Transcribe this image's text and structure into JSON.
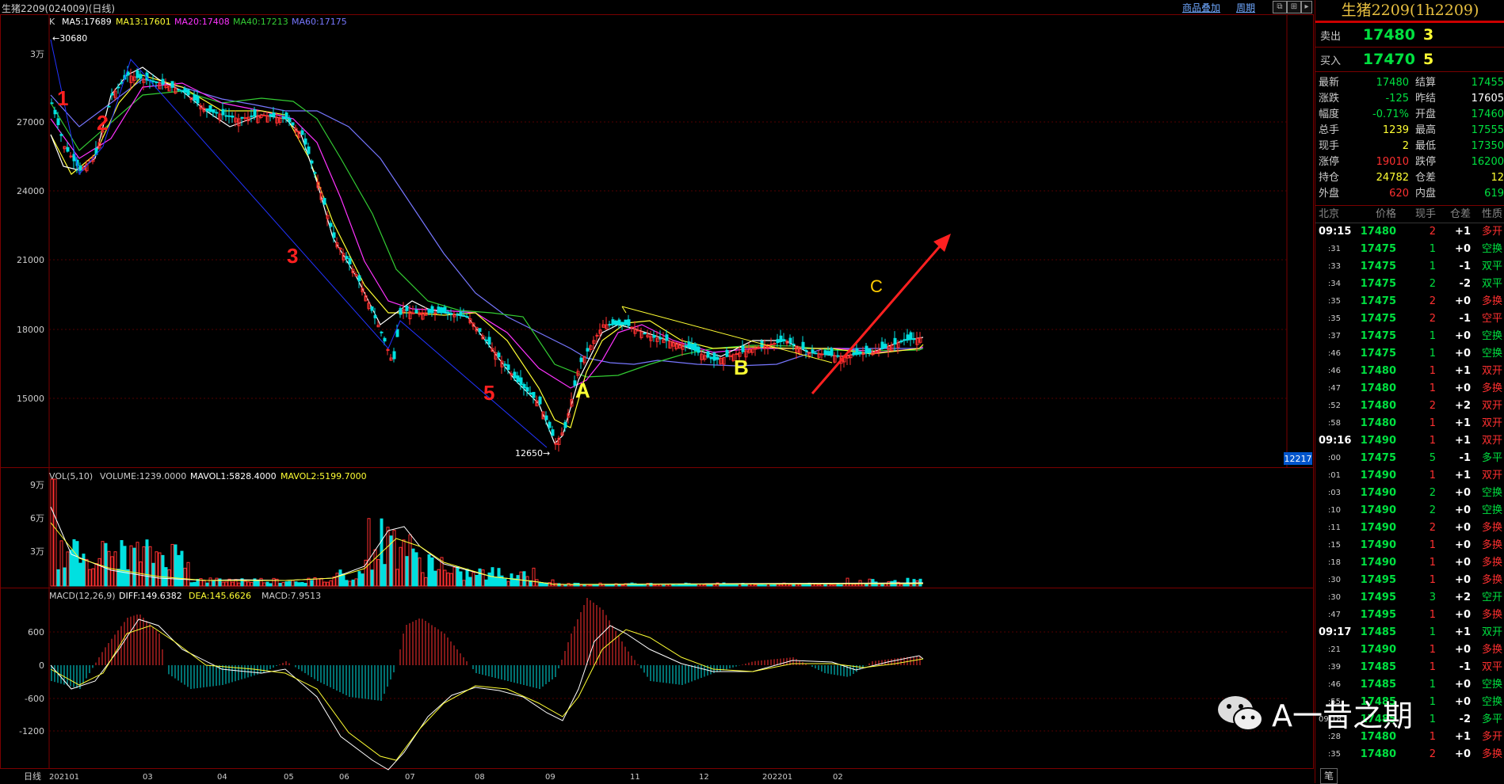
{
  "window": {
    "title": "生猪2209(024009)(日线)",
    "link1": "商品叠加",
    "link2": "周期"
  },
  "main_legend": {
    "k": "K",
    "ma5": "MA5:17689",
    "ma13": "MA13:17601",
    "ma20": "MA20:17408",
    "ma40": "MA40:17213",
    "ma60": "MA60:17175"
  },
  "price_axis": [
    "3万",
    "27000",
    "24000",
    "21000",
    "18000",
    "15000"
  ],
  "max_label": "30680",
  "min_label": "12650",
  "current_price_tag": "12217",
  "wave_labels": [
    "1",
    "2",
    "3",
    "5",
    "A",
    "B",
    "C"
  ],
  "vol_legend": {
    "title": "VOL(5,10)",
    "volume": "VOLUME:1239.0000",
    "mavol1": "MAVOL1:5828.4000",
    "mavol2": "MAVOL2:5199.7000"
  },
  "vol_axis": [
    "9万",
    "6万",
    "3万"
  ],
  "macd_legend": {
    "title": "MACD(12,26,9)",
    "diff": "DIFF:149.6382",
    "dea": "DEA:145.6626",
    "macd": "MACD:7.9513"
  },
  "macd_axis": [
    "600",
    "0",
    "-600",
    "-1200"
  ],
  "x_axis": {
    "period": "日线",
    "labels": [
      "202101",
      "03",
      "04",
      "05",
      "06",
      "07",
      "08",
      "09",
      "11",
      "12",
      "202201",
      "02"
    ]
  },
  "side": {
    "title": "生猪2209(1h2209)",
    "sell_label": "卖出",
    "sell_price": "17480",
    "sell_qty": "3",
    "buy_label": "买入",
    "buy_price": "17470",
    "buy_qty": "5",
    "stats": [
      {
        "l1": "最新",
        "v1": "17480",
        "c1": "#00e040",
        "l2": "结算",
        "v2": "17455",
        "c2": "#00e040"
      },
      {
        "l1": "涨跌",
        "v1": "-125",
        "c1": "#00e040",
        "l2": "昨结",
        "v2": "17605",
        "c2": "#ffffff"
      },
      {
        "l1": "幅度",
        "v1": "-0.71%",
        "c1": "#00e040",
        "l2": "开盘",
        "v2": "17460",
        "c2": "#00e040"
      },
      {
        "l1": "总手",
        "v1": "1239",
        "c1": "#ffff33",
        "l2": "最高",
        "v2": "17555",
        "c2": "#00e040"
      },
      {
        "l1": "现手",
        "v1": "2",
        "c1": "#ffff33",
        "l2": "最低",
        "v2": "17350",
        "c2": "#00e040"
      },
      {
        "l1": "涨停",
        "v1": "19010",
        "c1": "#ff3030",
        "l2": "跌停",
        "v2": "16200",
        "c2": "#00e040"
      },
      {
        "l1": "持仓",
        "v1": "24782",
        "c1": "#ffff33",
        "l2": "仓差",
        "v2": "12",
        "c2": "#ffff33"
      },
      {
        "l1": "外盘",
        "v1": "620",
        "c1": "#ff3030",
        "l2": "内盘",
        "v2": "619",
        "c2": "#00e040"
      }
    ],
    "tick_headers": [
      "北京",
      "价格",
      "现手",
      "仓差",
      "性质"
    ],
    "ticks": [
      {
        "t": "09:15",
        "big": true,
        "p": "17480",
        "q": "2",
        "qc": "#ff3030",
        "d": "+1",
        "n": "多开",
        "nc": "#ff3030"
      },
      {
        "t": ":31",
        "p": "17475",
        "q": "1",
        "qc": "#00e040",
        "d": "+0",
        "n": "空换",
        "nc": "#00e040"
      },
      {
        "t": ":33",
        "p": "17475",
        "q": "1",
        "qc": "#00e040",
        "d": "-1",
        "n": "双平",
        "nc": "#00e040"
      },
      {
        "t": ":34",
        "p": "17475",
        "q": "2",
        "qc": "#00e040",
        "d": "-2",
        "n": "双平",
        "nc": "#00e040"
      },
      {
        "t": ":35",
        "p": "17475",
        "q": "2",
        "qc": "#ff3030",
        "d": "+0",
        "n": "多换",
        "nc": "#ff3030"
      },
      {
        "t": ":35",
        "p": "17475",
        "q": "2",
        "qc": "#ff3030",
        "d": "-1",
        "n": "空平",
        "nc": "#ff3030"
      },
      {
        "t": ":37",
        "p": "17475",
        "q": "1",
        "qc": "#00e040",
        "d": "+0",
        "n": "空换",
        "nc": "#00e040"
      },
      {
        "t": ":46",
        "p": "17475",
        "q": "1",
        "qc": "#00e040",
        "d": "+0",
        "n": "空换",
        "nc": "#00e040"
      },
      {
        "t": ":46",
        "p": "17480",
        "q": "1",
        "qc": "#ff3030",
        "d": "+1",
        "n": "双开",
        "nc": "#ff3030"
      },
      {
        "t": ":47",
        "p": "17480",
        "q": "1",
        "qc": "#ff3030",
        "d": "+0",
        "n": "多换",
        "nc": "#ff3030"
      },
      {
        "t": ":52",
        "p": "17480",
        "q": "2",
        "qc": "#ff3030",
        "d": "+2",
        "n": "双开",
        "nc": "#ff3030"
      },
      {
        "t": ":58",
        "p": "17480",
        "q": "1",
        "qc": "#ff3030",
        "d": "+1",
        "n": "双开",
        "nc": "#ff3030"
      },
      {
        "t": "09:16",
        "big": true,
        "p": "17490",
        "q": "1",
        "qc": "#ff3030",
        "d": "+1",
        "n": "双开",
        "nc": "#ff3030"
      },
      {
        "t": ":00",
        "p": "17475",
        "q": "5",
        "qc": "#00e040",
        "d": "-1",
        "n": "多平",
        "nc": "#00e040"
      },
      {
        "t": ":01",
        "p": "17490",
        "q": "1",
        "qc": "#ff3030",
        "d": "+1",
        "n": "双开",
        "nc": "#ff3030"
      },
      {
        "t": ":03",
        "p": "17490",
        "q": "2",
        "qc": "#00e040",
        "d": "+0",
        "n": "空换",
        "nc": "#00e040"
      },
      {
        "t": ":10",
        "p": "17490",
        "q": "2",
        "qc": "#00e040",
        "d": "+0",
        "n": "空换",
        "nc": "#00e040"
      },
      {
        "t": ":11",
        "p": "17490",
        "q": "2",
        "qc": "#ff3030",
        "d": "+0",
        "n": "多换",
        "nc": "#ff3030"
      },
      {
        "t": ":15",
        "p": "17490",
        "q": "1",
        "qc": "#ff3030",
        "d": "+0",
        "n": "多换",
        "nc": "#ff3030"
      },
      {
        "t": ":18",
        "p": "17490",
        "q": "1",
        "qc": "#ff3030",
        "d": "+0",
        "n": "多换",
        "nc": "#ff3030"
      },
      {
        "t": ":30",
        "p": "17495",
        "q": "1",
        "qc": "#ff3030",
        "d": "+0",
        "n": "多换",
        "nc": "#ff3030"
      },
      {
        "t": ":30",
        "p": "17495",
        "q": "3",
        "qc": "#00e040",
        "d": "+2",
        "n": "空开",
        "nc": "#00e040"
      },
      {
        "t": ":47",
        "p": "17495",
        "q": "1",
        "qc": "#ff3030",
        "d": "+0",
        "n": "多换",
        "nc": "#ff3030"
      },
      {
        "t": "09:17",
        "big": true,
        "p": "17485",
        "q": "1",
        "qc": "#00e040",
        "d": "+1",
        "n": "双开",
        "nc": "#00e040"
      },
      {
        "t": ":21",
        "p": "17490",
        "q": "1",
        "qc": "#ff3030",
        "d": "+0",
        "n": "多换",
        "nc": "#ff3030"
      },
      {
        "t": ":39",
        "p": "17485",
        "q": "1",
        "qc": "#ff3030",
        "d": "-1",
        "n": "双平",
        "nc": "#ff3030"
      },
      {
        "t": ":46",
        "p": "17485",
        "q": "1",
        "qc": "#00e040",
        "d": "+0",
        "n": "空换",
        "nc": "#00e040"
      },
      {
        "t": ":55",
        "p": "17485",
        "q": "1",
        "qc": "#00e040",
        "d": "+0",
        "n": "空换",
        "nc": "#00e040"
      },
      {
        "t": "09:18",
        "p": "17485",
        "q": "1",
        "qc": "#00e040",
        "d": "-2",
        "n": "多平",
        "nc": "#00e040"
      },
      {
        "t": ":28",
        "p": "17480",
        "q": "1",
        "qc": "#ff3030",
        "d": "+1",
        "n": "多开",
        "nc": "#ff3030"
      },
      {
        "t": ":35",
        "p": "17480",
        "q": "2",
        "qc": "#ff3030",
        "d": "+0",
        "n": "多换",
        "nc": "#ff3030"
      }
    ],
    "footer_tab": "笔"
  },
  "watermark": "A一昔之期",
  "colors": {
    "up": "#ff3030",
    "down": "#00e0e0",
    "ma5": "#ffffff",
    "ma13": "#ffff33",
    "ma20": "#ff33ff",
    "ma40": "#33cc33",
    "ma60": "#7777ff",
    "panel_border": "#7a0000"
  }
}
